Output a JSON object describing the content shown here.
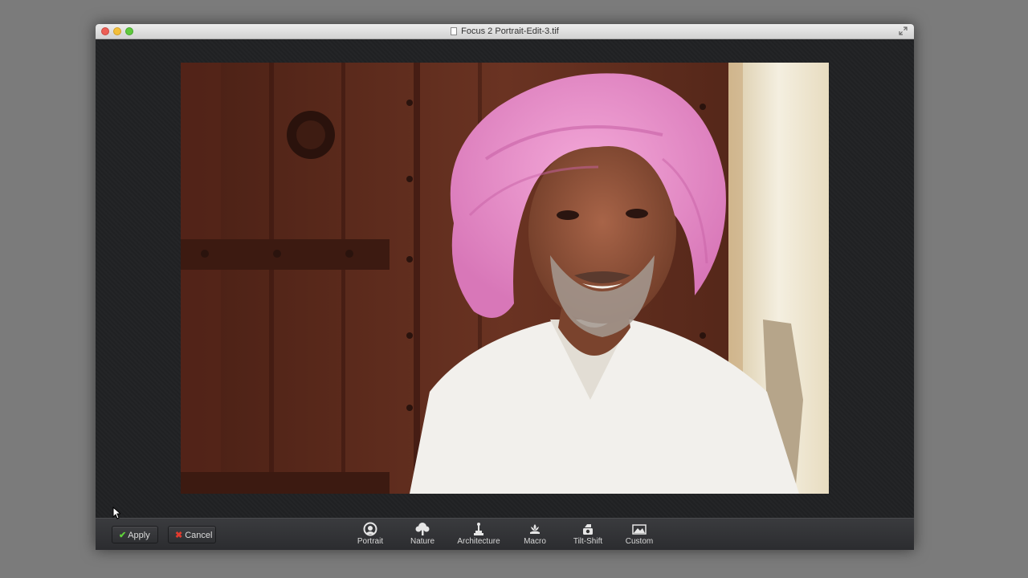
{
  "window": {
    "title": "Focus 2 Portrait-Edit-3.tif"
  },
  "toolbar": {
    "apply_label": "Apply",
    "cancel_label": "Cancel",
    "presets": [
      {
        "label": "Portrait",
        "icon": "portrait-icon"
      },
      {
        "label": "Nature",
        "icon": "tree-icon"
      },
      {
        "label": "Architecture",
        "icon": "statue-icon"
      },
      {
        "label": "Macro",
        "icon": "flower-icon"
      },
      {
        "label": "Tilt-Shift",
        "icon": "tilt-shift-icon"
      },
      {
        "label": "Custom",
        "icon": "custom-landscape-icon"
      }
    ]
  },
  "colors": {
    "apply_check": "#5fd23a",
    "cancel_x": "#e23b2e",
    "turban": "#e58fc8",
    "door": "#5b2b1c"
  }
}
